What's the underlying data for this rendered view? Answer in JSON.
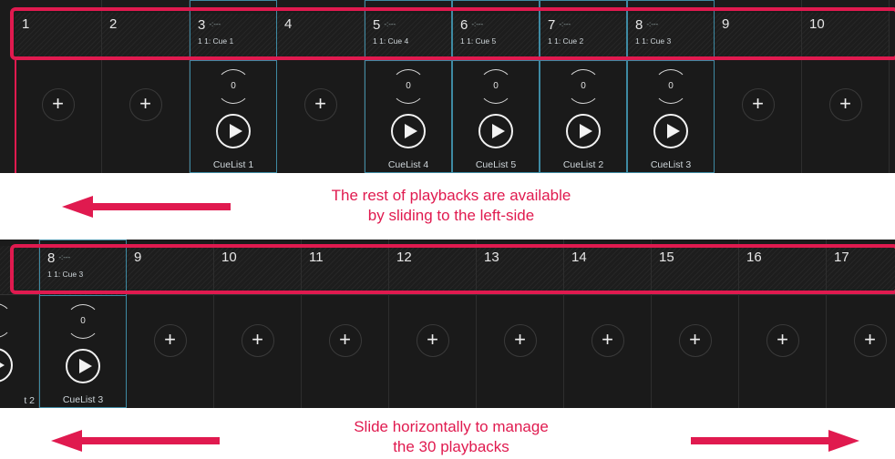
{
  "panel1": {
    "columns": [
      {
        "num": "1",
        "type": "empty"
      },
      {
        "num": "2",
        "type": "empty"
      },
      {
        "num": "3",
        "type": "cue",
        "status": "-:---",
        "cue": "1  1: Cue 1",
        "fader": "0",
        "cuelist": "CueList 1"
      },
      {
        "num": "4",
        "type": "empty"
      },
      {
        "num": "5",
        "type": "cue",
        "status": "-:---",
        "cue": "1  1: Cue 4",
        "fader": "0",
        "cuelist": "CueList 4"
      },
      {
        "num": "6",
        "type": "cue",
        "status": "-:---",
        "cue": "1  1: Cue 5",
        "fader": "0",
        "cuelist": "CueList 5"
      },
      {
        "num": "7",
        "type": "cue",
        "status": "-:---",
        "cue": "1  1: Cue 2",
        "fader": "0",
        "cuelist": "CueList 2"
      },
      {
        "num": "8",
        "type": "cue",
        "status": "-:---",
        "cue": "1  1: Cue 3",
        "fader": "0",
        "cuelist": "CueList 3"
      },
      {
        "num": "9",
        "type": "empty"
      },
      {
        "num": "10",
        "type": "empty"
      }
    ],
    "caption_line1": "The rest of playbacks are available",
    "caption_line2": "by sliding to the left-side"
  },
  "panel2": {
    "columns": [
      {
        "num": "",
        "type": "partial",
        "cuelist": "t 2"
      },
      {
        "num": "8",
        "type": "cue",
        "status": "-:---",
        "cue": "1  1: Cue 3",
        "fader": "0",
        "cuelist": "CueList 3"
      },
      {
        "num": "9",
        "type": "empty"
      },
      {
        "num": "10",
        "type": "empty"
      },
      {
        "num": "11",
        "type": "empty"
      },
      {
        "num": "12",
        "type": "empty"
      },
      {
        "num": "13",
        "type": "empty"
      },
      {
        "num": "14",
        "type": "empty"
      },
      {
        "num": "15",
        "type": "empty"
      },
      {
        "num": "16",
        "type": "empty"
      },
      {
        "num": "17",
        "type": "empty"
      }
    ],
    "caption_line1": "Slide horizontally to manage",
    "caption_line2": "the 30 playbacks"
  },
  "icons": {
    "add": "+",
    "play": "play-icon"
  },
  "colors": {
    "accent": "#e01a4f",
    "active_border": "#3e8aa3",
    "panel_bg": "#1b1b1b"
  }
}
